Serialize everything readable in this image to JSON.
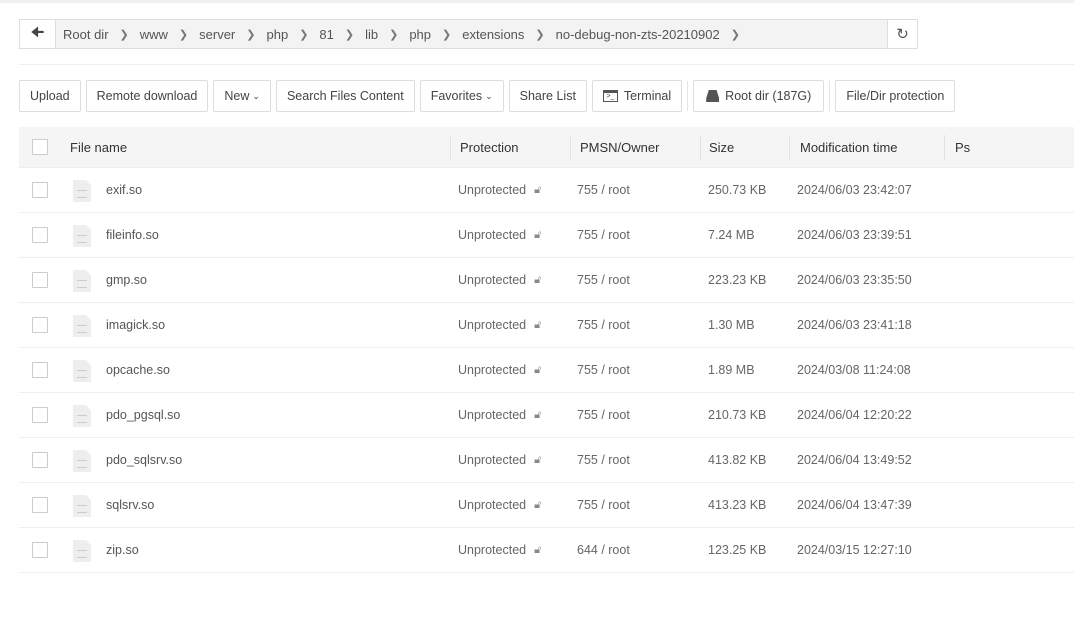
{
  "breadcrumb": [
    "Root dir",
    "www",
    "server",
    "php",
    "81",
    "lib",
    "php",
    "extensions",
    "no-debug-non-zts-20210902"
  ],
  "toolbar": {
    "upload": "Upload",
    "remote": "Remote download",
    "new": "New",
    "search": "Search Files Content",
    "favorites": "Favorites",
    "share": "Share List",
    "terminal": "Terminal",
    "rootdir": "Root dir (187G)",
    "protection": "File/Dir protection"
  },
  "columns": {
    "name": "File name",
    "protection": "Protection",
    "pmsn": "PMSN/Owner",
    "size": "Size",
    "mtime": "Modification time",
    "ps": "Ps"
  },
  "files": [
    {
      "name": "exif.so",
      "protection": "Unprotected",
      "pmsn": "755 / root",
      "size": "250.73 KB",
      "mtime": "2024/06/03 23:42:07"
    },
    {
      "name": "fileinfo.so",
      "protection": "Unprotected",
      "pmsn": "755 / root",
      "size": "7.24 MB",
      "mtime": "2024/06/03 23:39:51"
    },
    {
      "name": "gmp.so",
      "protection": "Unprotected",
      "pmsn": "755 / root",
      "size": "223.23 KB",
      "mtime": "2024/06/03 23:35:50"
    },
    {
      "name": "imagick.so",
      "protection": "Unprotected",
      "pmsn": "755 / root",
      "size": "1.30 MB",
      "mtime": "2024/06/03 23:41:18"
    },
    {
      "name": "opcache.so",
      "protection": "Unprotected",
      "pmsn": "755 / root",
      "size": "1.89 MB",
      "mtime": "2024/03/08 11:24:08"
    },
    {
      "name": "pdo_pgsql.so",
      "protection": "Unprotected",
      "pmsn": "755 / root",
      "size": "210.73 KB",
      "mtime": "2024/06/04 12:20:22"
    },
    {
      "name": "pdo_sqlsrv.so",
      "protection": "Unprotected",
      "pmsn": "755 / root",
      "size": "413.82 KB",
      "mtime": "2024/06/04 13:49:52"
    },
    {
      "name": "sqlsrv.so",
      "protection": "Unprotected",
      "pmsn": "755 / root",
      "size": "413.23 KB",
      "mtime": "2024/06/04 13:47:39"
    },
    {
      "name": "zip.so",
      "protection": "Unprotected",
      "pmsn": "644 / root",
      "size": "123.25 KB",
      "mtime": "2024/03/15 12:27:10"
    }
  ]
}
